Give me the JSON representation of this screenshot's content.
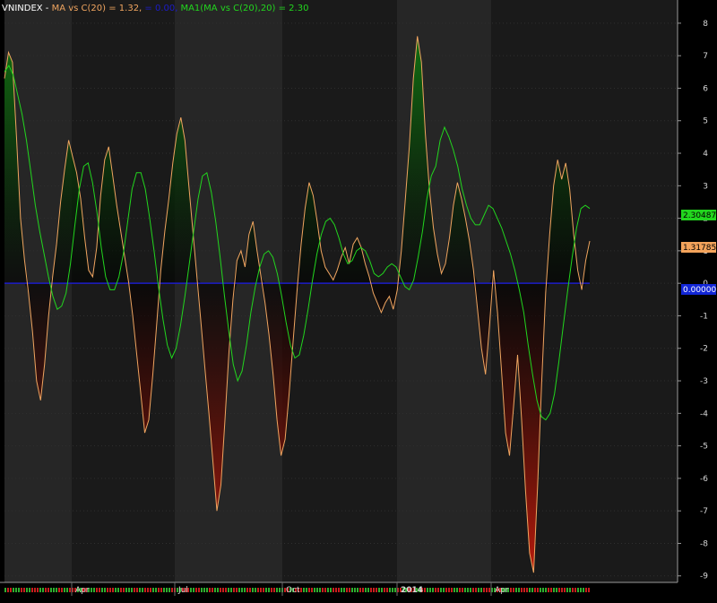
{
  "header": {
    "symbol": "VNINDEX",
    "sep": " - ",
    "ma_label": "MA vs C(20) = 1.32,",
    "zero_label": " = 0.00,",
    "ma1_label": "MA1(MA vs C(20),20) = 2.30"
  },
  "colors": {
    "background": "#000000",
    "panel_light": "#262626",
    "panel_dark": "#1a1a1a",
    "ma_line": "#f0a560",
    "ma1_line": "#22d61e",
    "zero_line": "#1c1cc8",
    "fill_pos": "#127012",
    "fill_neg": "#b81b0c",
    "ma_tag": "#f3a35b",
    "ma1_tag": "#22d61e",
    "zero_tag": "#1226d6"
  },
  "value_tags": {
    "ma": "1.31785",
    "ma1": "2.30487",
    "zero": "0.00000"
  },
  "chart_data": {
    "type": "line",
    "ylim": [
      -9.2,
      8.3
    ],
    "y_ticks": [
      "8",
      "7",
      "6",
      "5",
      "4",
      "3",
      "2",
      "1",
      "0",
      "-1",
      "-2",
      "-3",
      "-4",
      "-5",
      "-6",
      "-7",
      "-8",
      "-9"
    ],
    "x_ticks": [
      "Apr",
      "Jul",
      "Oct",
      "2014",
      "Apr"
    ],
    "series": [
      {
        "name": "MA vs C(20)",
        "values": [
          6.3,
          7.1,
          6.8,
          4.5,
          2.0,
          0.7,
          -0.3,
          -1.5,
          -3.0,
          -3.6,
          -2.5,
          -1.0,
          0.2,
          1.2,
          2.5,
          3.5,
          4.4,
          3.9,
          3.4,
          2.6,
          1.4,
          0.4,
          0.2,
          1.1,
          2.7,
          3.8,
          4.2,
          3.3,
          2.4,
          1.6,
          0.8,
          0.0,
          -1.0,
          -2.2,
          -3.4,
          -4.6,
          -4.2,
          -2.8,
          -1.2,
          0.4,
          1.6,
          2.6,
          3.7,
          4.6,
          5.1,
          4.4,
          3.0,
          1.6,
          0.2,
          -1.2,
          -2.6,
          -4.0,
          -5.5,
          -7.0,
          -6.2,
          -4.2,
          -2.1,
          -0.5,
          0.7,
          1.0,
          0.5,
          1.5,
          1.9,
          1.0,
          0.2,
          -0.6,
          -1.6,
          -2.8,
          -4.2,
          -5.3,
          -4.8,
          -3.4,
          -1.8,
          -0.2,
          1.2,
          2.3,
          3.1,
          2.7,
          1.9,
          1.0,
          0.5,
          0.3,
          0.1,
          0.4,
          0.8,
          1.1,
          0.6,
          1.2,
          1.4,
          1.1,
          0.6,
          0.2,
          -0.3,
          -0.6,
          -0.9,
          -0.6,
          -0.4,
          -0.8,
          -0.2,
          1.0,
          2.6,
          4.2,
          6.3,
          7.6,
          6.8,
          4.6,
          2.9,
          1.7,
          0.9,
          0.3,
          0.6,
          1.4,
          2.4,
          3.1,
          2.6,
          2.0,
          1.3,
          0.4,
          -0.8,
          -2.0,
          -2.8,
          -1.3,
          0.4,
          -0.9,
          -2.7,
          -4.6,
          -5.3,
          -3.8,
          -2.2,
          -4.2,
          -6.4,
          -8.3,
          -8.9,
          -6.2,
          -3.1,
          -0.3,
          1.5,
          3.0,
          3.8,
          3.2,
          3.7,
          2.9,
          1.5,
          0.4,
          -0.2,
          0.7,
          1.3
        ]
      },
      {
        "name": "MA1(MA vs C(20),20)",
        "values": [
          6.5,
          6.7,
          6.4,
          5.8,
          5.2,
          4.4,
          3.4,
          2.4,
          1.6,
          0.9,
          0.2,
          -0.4,
          -0.8,
          -0.7,
          -0.3,
          0.6,
          1.8,
          2.9,
          3.6,
          3.7,
          3.1,
          2.2,
          1.1,
          0.2,
          -0.2,
          -0.2,
          0.2,
          0.9,
          1.9,
          2.9,
          3.4,
          3.4,
          2.9,
          2.0,
          1.0,
          -0.1,
          -1.1,
          -1.9,
          -2.3,
          -2.0,
          -1.3,
          -0.4,
          0.6,
          1.6,
          2.6,
          3.3,
          3.4,
          2.8,
          1.9,
          0.8,
          -0.4,
          -1.5,
          -2.5,
          -3.0,
          -2.7,
          -1.9,
          -0.9,
          -0.1,
          0.5,
          0.9,
          1.0,
          0.8,
          0.3,
          -0.4,
          -1.2,
          -1.9,
          -2.3,
          -2.2,
          -1.6,
          -0.8,
          0.1,
          0.9,
          1.5,
          1.9,
          2.0,
          1.8,
          1.4,
          0.9,
          0.6,
          0.7,
          1.0,
          1.1,
          1.0,
          0.7,
          0.3,
          0.2,
          0.3,
          0.5,
          0.6,
          0.5,
          0.2,
          -0.1,
          -0.2,
          0.1,
          0.8,
          1.6,
          2.6,
          3.3,
          3.6,
          4.4,
          4.8,
          4.5,
          4.1,
          3.6,
          2.9,
          2.4,
          2.0,
          1.8,
          1.8,
          2.1,
          2.4,
          2.3,
          2.0,
          1.7,
          1.3,
          0.9,
          0.4,
          -0.2,
          -0.9,
          -1.9,
          -2.8,
          -3.6,
          -4.1,
          -4.2,
          -4.0,
          -3.4,
          -2.4,
          -1.3,
          -0.2,
          0.8,
          1.7,
          2.3,
          2.4,
          2.3
        ]
      }
    ]
  }
}
